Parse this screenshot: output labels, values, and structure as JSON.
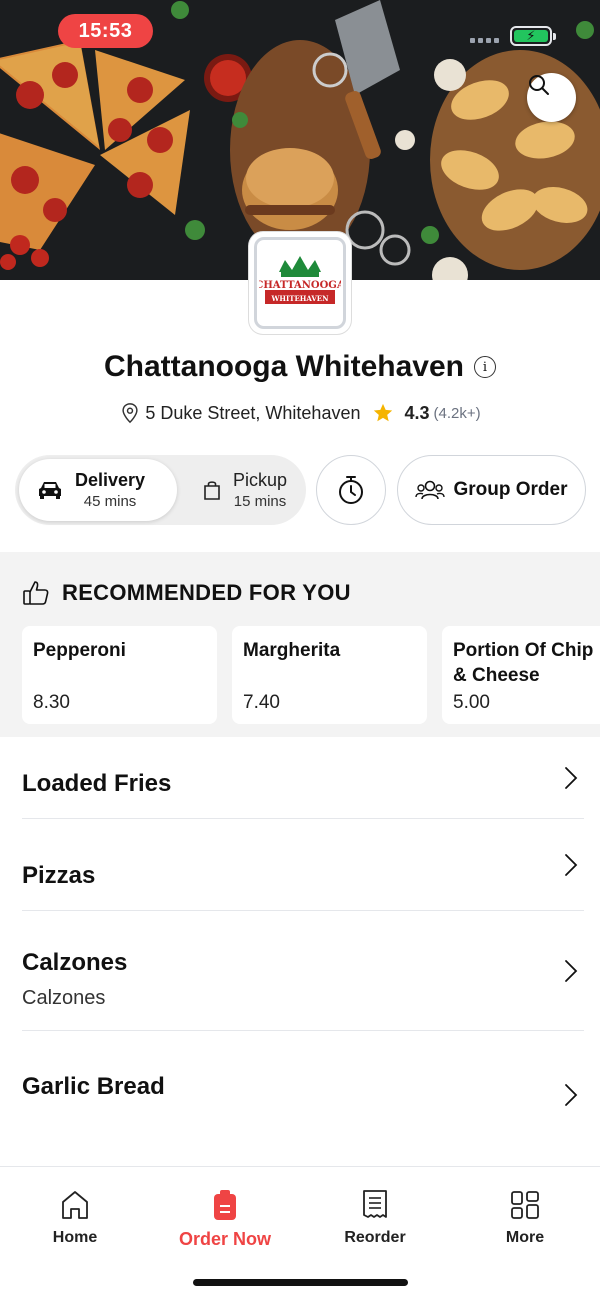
{
  "status_bar": {
    "time": "15:53",
    "battery_symbol": "⚡"
  },
  "hero": {
    "search_icon": "search-icon"
  },
  "restaurant": {
    "name": "Chattanooga Whitehaven",
    "logo_text_top": "CHATTANOOGA",
    "logo_text_bottom": "WHITEHAVEN",
    "address": "5 Duke Street, Whitehaven",
    "rating": "4.3",
    "rating_count": "(4.2k+)"
  },
  "order_mode": {
    "delivery": {
      "label": "Delivery",
      "time": "45 mins",
      "selected": true
    },
    "pickup": {
      "label": "Pickup",
      "time": "15 mins",
      "selected": false
    },
    "schedule_icon": "timer-icon",
    "group_order_label": "Group Order"
  },
  "recommended": {
    "title": "RECOMMENDED FOR YOU",
    "items": [
      {
        "name": "Pepperoni",
        "price": "8.30"
      },
      {
        "name": "Margherita",
        "price": "7.40"
      },
      {
        "name": "Portion Of Chip & Cheese",
        "price": "5.00",
        "name_line1": "Portion Of Chip",
        "name_line2": "& Cheese"
      }
    ]
  },
  "categories": [
    {
      "name": "Loaded Fries",
      "subtitle": ""
    },
    {
      "name": "Pizzas",
      "subtitle": ""
    },
    {
      "name": "Calzones",
      "subtitle": "Calzones"
    },
    {
      "name": "Garlic Bread",
      "subtitle": ""
    }
  ],
  "bottom_nav": {
    "items": [
      {
        "label": "Home",
        "icon": "home-icon",
        "active": false
      },
      {
        "label": "Order Now",
        "icon": "order-icon",
        "active": true
      },
      {
        "label": "Reorder",
        "icon": "receipt-icon",
        "active": false
      },
      {
        "label": "More",
        "icon": "grid-icon",
        "active": false
      }
    ]
  },
  "colors": {
    "accent": "#ef4444",
    "star": "#f5b400",
    "battery": "#22c55e"
  }
}
